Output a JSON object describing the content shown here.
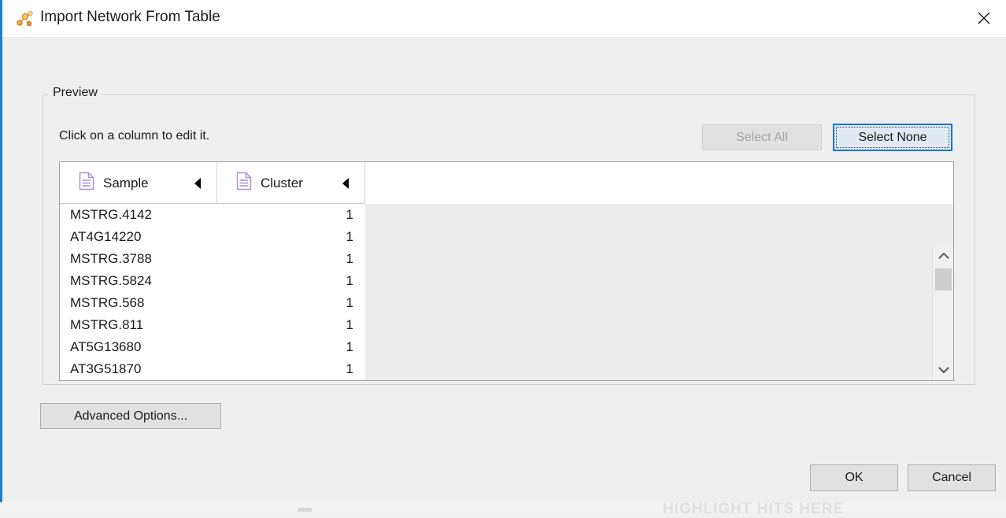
{
  "window": {
    "title": "Import Network From Table",
    "app_icon": "network-import-icon",
    "close_label": "×",
    "accent_color": "#1b82c8"
  },
  "preview": {
    "legend": "Preview",
    "hint": "Click on a column to edit it.",
    "select_all_label": "Select All",
    "select_all_disabled": true,
    "select_none_label": "Select None",
    "select_none_focused": true
  },
  "table": {
    "columns": [
      {
        "label": "Sample",
        "icon": "document-icon",
        "sort_icon": "triangle-left-icon"
      },
      {
        "label": "Cluster",
        "icon": "document-icon",
        "sort_icon": "triangle-left-icon"
      }
    ],
    "rows": [
      {
        "sample": "MSTRG.4142",
        "cluster": "1"
      },
      {
        "sample": "AT4G14220",
        "cluster": "1"
      },
      {
        "sample": "MSTRG.3788",
        "cluster": "1"
      },
      {
        "sample": "MSTRG.5824",
        "cluster": "1"
      },
      {
        "sample": "MSTRG.568",
        "cluster": "1"
      },
      {
        "sample": "MSTRG.811",
        "cluster": "1"
      },
      {
        "sample": "AT5G13680",
        "cluster": "1"
      },
      {
        "sample": "AT3G51870",
        "cluster": "1"
      }
    ],
    "scrollbar": {
      "up_icon": "chevron-up-icon",
      "down_icon": "chevron-down-icon"
    }
  },
  "buttons": {
    "advanced_options": "Advanced Options...",
    "ok": "OK",
    "cancel": "Cancel"
  },
  "backdrop": {
    "ghost_text": "HIGHLIGHT HITS HERE"
  }
}
